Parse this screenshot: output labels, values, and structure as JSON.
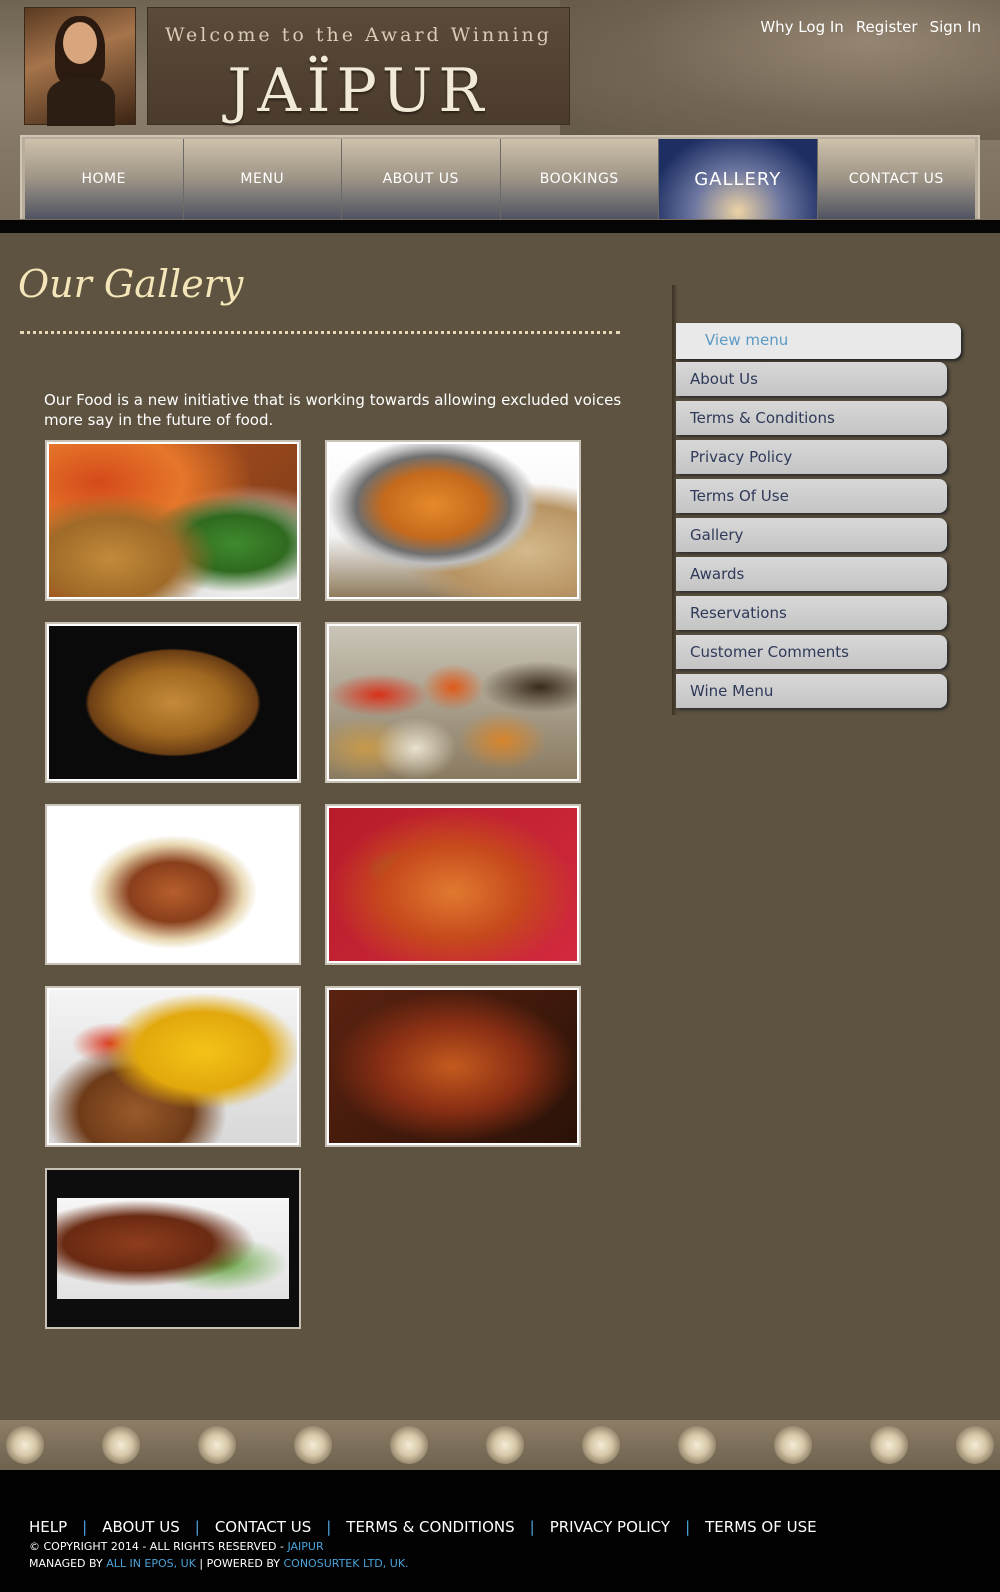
{
  "header": {
    "banner_subtitle": "Welcome to the Award Winning",
    "banner_title": "JAÏPUR",
    "top_links": [
      "Why Log In",
      "Register",
      "Sign In"
    ]
  },
  "nav": {
    "items": [
      "HOME",
      "MENU",
      "ABOUT US",
      "BOOKINGS",
      "GALLERY",
      "CONTACT US"
    ],
    "active": "GALLERY"
  },
  "main": {
    "title": "Our Gallery",
    "intro": "Our Food is a new initiative that is working towards allowing excluded voices more say in the future of food."
  },
  "sidebar": {
    "header": "View menu",
    "items": [
      "About Us",
      "Terms & Conditions",
      "Privacy Policy",
      "Terms Of Use",
      "Gallery",
      "Awards",
      "Reservations",
      "Customer Comments",
      "Wine Menu"
    ]
  },
  "footer": {
    "links": [
      "HELP",
      "ABOUT US",
      "CONTACT US",
      "TERMS & CONDITIONS",
      "PRIVACY POLICY",
      "TERMS OF USE"
    ],
    "copyright_prefix": "© COPYRIGHT 2014 - ALL RIGHTS RESERVED -",
    "copyright_brand": "JAIPUR",
    "managed_prefix": "MANAGED BY",
    "managed_by": "ALL IN EPOS, UK",
    "separator": "|",
    "powered_prefix": "POWERED BY",
    "powered_by": "CONOSURTEK LTD, UK."
  },
  "colors": {
    "background": "#5e5340",
    "title": "#f5e6b9",
    "link_blue": "#4ba3d9",
    "nav_active": "#1c2e62"
  }
}
